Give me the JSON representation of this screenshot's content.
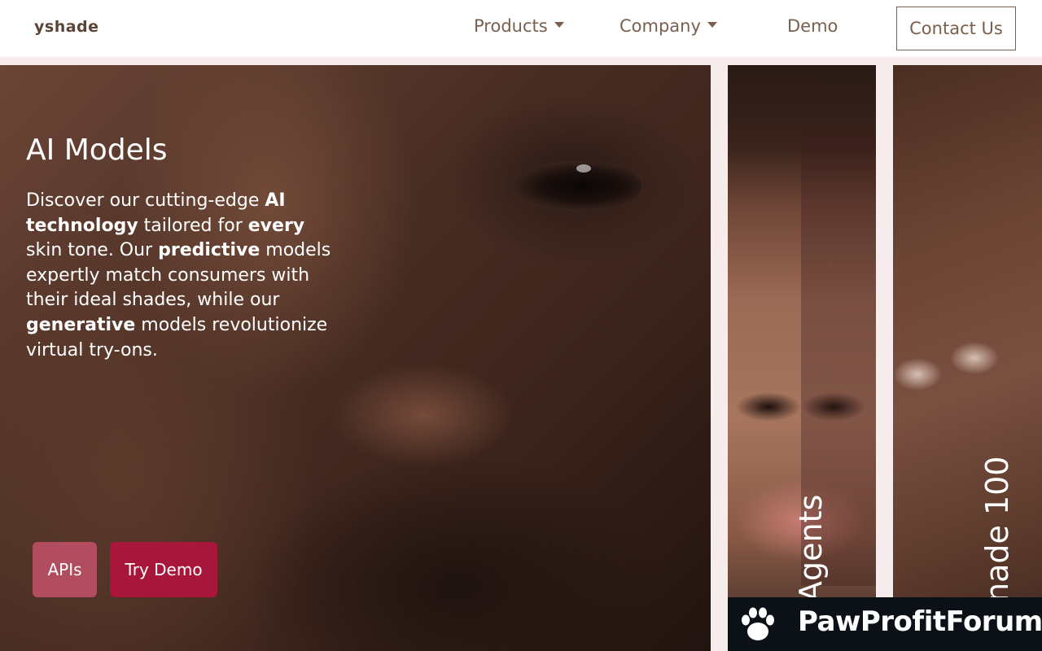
{
  "header": {
    "logo": "yshade",
    "nav": {
      "products": "Products",
      "company": "Company",
      "demo": "Demo"
    },
    "contact_label": "Contact Us"
  },
  "hero": {
    "title": "AI Models",
    "desc": {
      "t1": "Discover our cutting-edge ",
      "b1": "AI technology",
      "t2": " tailored for ",
      "b2": "every",
      "t3": " skin tone. Our ",
      "b3": "predictive",
      "t4": " models expertly match consumers with their ideal shades, while our ",
      "b4": "generative",
      "t5": " models revolutionize virtual try-ons."
    },
    "buttons": {
      "apis": "APIs",
      "try_demo": "Try Demo"
    }
  },
  "panels": {
    "agents": "Agents",
    "shade": "nade 100"
  },
  "watermark": {
    "text": "PawProfitForum"
  },
  "colors": {
    "brand_text": "#7a5f4e",
    "apis_button": "#b24c5f",
    "try_demo_button": "#a8163b",
    "page_background": "#f6ecec"
  }
}
